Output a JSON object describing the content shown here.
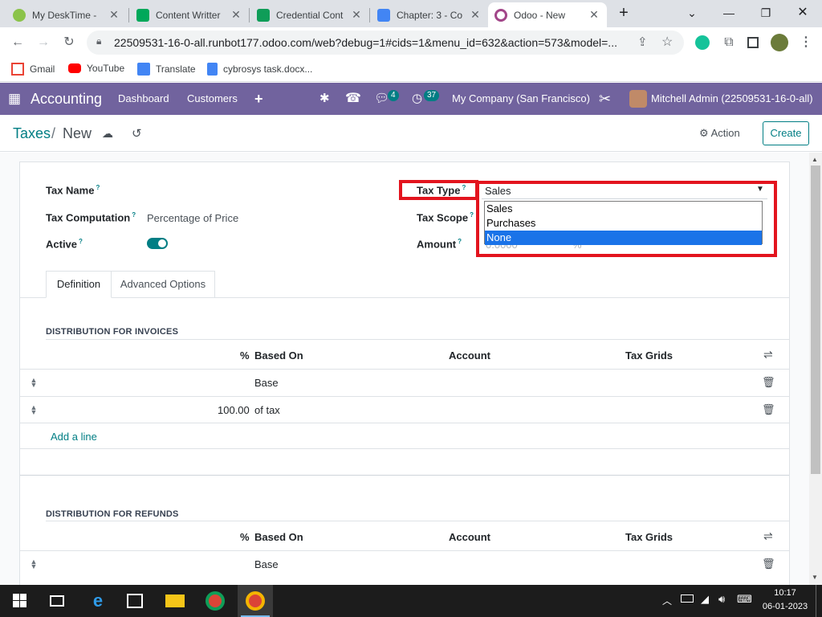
{
  "browser": {
    "tabs": [
      {
        "title": "My DeskTime - ",
        "icon": "desktime-icon",
        "active": false
      },
      {
        "title": "Content Writter",
        "icon": "google-chat-icon",
        "active": false
      },
      {
        "title": "Credential Cont",
        "icon": "google-sheets-icon",
        "active": false
      },
      {
        "title": "Chapter: 3 - Co",
        "icon": "google-docs-icon",
        "active": false
      },
      {
        "title": "Odoo - New",
        "icon": "odoo-icon",
        "active": true
      }
    ],
    "new_tab": "+",
    "url": "22509531-16-0-all.runbot177.odoo.com/web?debug=1#cids=1&menu_id=632&action=573&model=...",
    "bookmarks": [
      {
        "label": "Gmail",
        "icon": "gmail-icon"
      },
      {
        "label": "YouTube",
        "icon": "youtube-icon"
      },
      {
        "label": "Translate",
        "icon": "translate-icon"
      },
      {
        "label": "cybrosys task.docx...",
        "icon": "docs-icon"
      }
    ]
  },
  "odoo_nav": {
    "app": "Accounting",
    "menus": [
      "Dashboard",
      "Customers"
    ],
    "add": "+",
    "messages_count": "4",
    "activities_count": "37",
    "company": "My Company (San Francisco)",
    "user": "Mitchell Admin (22509531-16-0-all)"
  },
  "control_panel": {
    "breadcrumb_root": "Taxes",
    "breadcrumb_sep": "/",
    "breadcrumb_current": "New",
    "action_label": "Action",
    "create_label": "Create"
  },
  "form": {
    "tax_name_label": "Tax Name",
    "tax_computation_label": "Tax Computation",
    "tax_computation_value": "Percentage of Price",
    "active_label": "Active",
    "active_on": true,
    "tax_type_label": "Tax Type",
    "tax_type_value": "Sales",
    "tax_scope_label": "Tax Scope",
    "amount_label": "Amount",
    "amount_value": "0.0000",
    "amount_unit": "%",
    "help_mark": "?",
    "tax_type_options": [
      "Sales",
      "Purchases",
      "None"
    ],
    "tax_type_highlighted": "None"
  },
  "tabs": [
    "Definition",
    "Advanced Options"
  ],
  "invoices": {
    "title": "DISTRIBUTION FOR INVOICES",
    "columns": {
      "pct": "%",
      "based_on": "Based On",
      "account": "Account",
      "tax_grids": "Tax Grids"
    },
    "rows": [
      {
        "pct": "",
        "based_on": "Base"
      },
      {
        "pct": "100.00",
        "based_on": "of tax"
      }
    ],
    "add_line": "Add a line"
  },
  "refunds": {
    "title": "DISTRIBUTION FOR REFUNDS",
    "columns": {
      "pct": "%",
      "based_on": "Based On",
      "account": "Account",
      "tax_grids": "Tax Grids"
    },
    "rows": [
      {
        "pct": "",
        "based_on": "Base"
      }
    ]
  },
  "taskbar": {
    "time": "10:17",
    "date": "06-01-2023"
  },
  "colors": {
    "odoo_primary": "#71639e",
    "odoo_teal": "#017e84",
    "highlight_red": "#e3141e",
    "selection_blue": "#1a73e8"
  }
}
